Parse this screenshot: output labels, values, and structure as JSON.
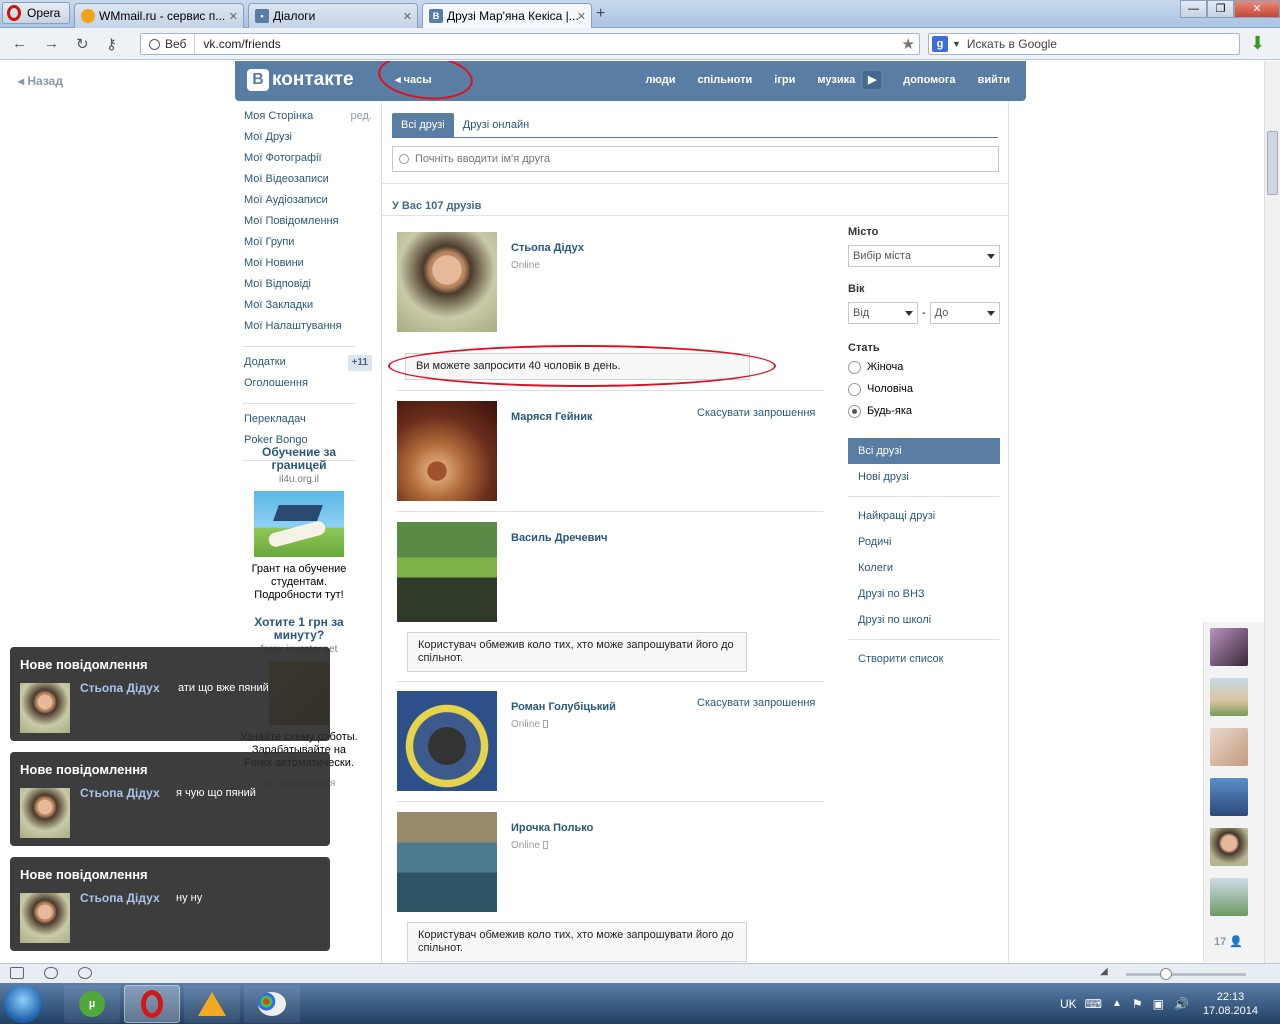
{
  "browser": {
    "menu_label": "Opera",
    "tabs": [
      {
        "title": "WMmail.ru - сервис п...",
        "icon": "wmmail-favicon"
      },
      {
        "title": "Діалоги",
        "icon": "dialog-favicon"
      },
      {
        "title": "Друзі Мар'яна Кекіса |...",
        "icon": "vk-favicon",
        "active": true
      }
    ],
    "address": {
      "badge": "Веб",
      "url": "vk.com/friends"
    },
    "search": {
      "placeholder": "Искать в Google"
    }
  },
  "page": {
    "back_label": "Назад",
    "header": {
      "logo_text": "контакте",
      "logo_letter": "В",
      "hours_link": "часы",
      "menu": [
        "люди",
        "спільноти",
        "ігри",
        "музика",
        "допомога",
        "вийти"
      ]
    },
    "left_nav": {
      "items": [
        "Моя Сторінка",
        "Мої Друзі",
        "Мої Фотографії",
        "Мої Відеозаписи",
        "Мої Аудіозаписи",
        "Мої Повідомлення",
        "Мої Групи",
        "Мої Новини",
        "Мої Відповіді",
        "Мої Закладки",
        "Мої Налаштування"
      ],
      "edit_label": "ред.",
      "apps_label": "Додатки",
      "apps_badge": "+11",
      "ads_label": "Оголошення",
      "extra": [
        "Перекладач",
        "Poker Bongo"
      ]
    },
    "ad1": {
      "title": "Обучение за границей",
      "domain": "il4u.org.il",
      "text": "Грант на обучение студентам. Подробности тут!"
    },
    "ad2": {
      "title": "Хотите 1 грн за минуту?",
      "domain": "forex-investor.net",
      "text": "Узнайте схему работы. Зарабатывайте на Forex автоматически."
    },
    "ads_all": "Всі оголошення",
    "friends": {
      "tabs": [
        "Всі друзі",
        "Друзі онлайн"
      ],
      "search_placeholder": "Почніть вводити ім'я друга",
      "count_text": "У Вас 107 друзів",
      "invite_notice": "Ви можете запросити 40 чоловік в день.",
      "restricted_notice": "Користувач обмежив коло тих, хто може запрошувати його до спільнот.",
      "list": [
        {
          "name": "Стьопа Дідух",
          "status": "Online",
          "action": ""
        },
        {
          "name": "Маряся Гейник",
          "status": "",
          "action": "Скасувати запрошення"
        },
        {
          "name": "Василь Дречевич",
          "status": "",
          "action": ""
        },
        {
          "name": "Роман Голубіцький",
          "status": "Online",
          "action": "Скасувати запрошення"
        },
        {
          "name": "Ирочка Полько",
          "status": "Online",
          "action": ""
        }
      ]
    },
    "filter": {
      "city_label": "Місто",
      "city_select": "Вибір міста",
      "age_label": "Вік",
      "age_from": "Від",
      "age_to": "До",
      "age_dash": "-",
      "sex_label": "Стать",
      "sex_options": [
        "Жіноча",
        "Чоловіча",
        "Будь-яка"
      ],
      "sex_selected": "Будь-яка",
      "menu1": [
        "Всі друзі",
        "Нові друзі"
      ],
      "menu2": [
        "Найкращі друзі",
        "Родичі",
        "Колеги",
        "Друзі по ВНЗ",
        "Друзі по школі"
      ],
      "create_list": "Створити список"
    },
    "online_count": "17"
  },
  "notifications": [
    {
      "title": "Нове повідомлення",
      "name": "Стьопа Дідух",
      "message": "ати що вже пяний"
    },
    {
      "title": "Нове повідомлення",
      "name": "Стьопа Дідух",
      "message": "я чую що пяний"
    },
    {
      "title": "Нове повідомлення",
      "name": "Стьопа Дідух",
      "message": "ну ну"
    }
  ],
  "taskbar": {
    "lang": "UK",
    "time": "22:13",
    "date": "17.08.2014"
  },
  "colors": {
    "vk_blue": "#597da3",
    "link": "#2b587a",
    "annotation_red": "#e01020"
  }
}
